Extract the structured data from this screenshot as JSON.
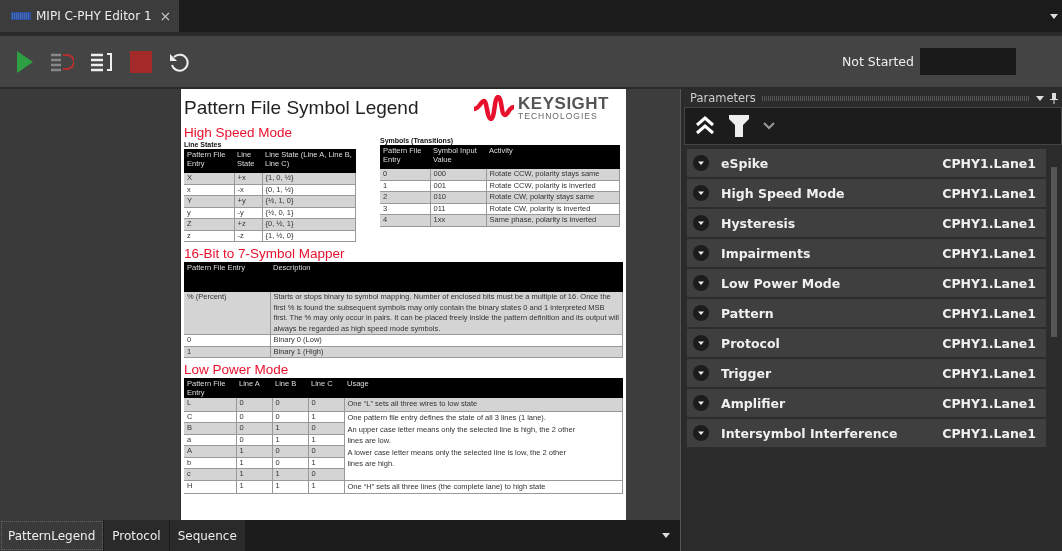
{
  "editor_tab": {
    "title": "MIPI C-PHY Editor 1",
    "close": "×"
  },
  "status": {
    "label": "Not Started"
  },
  "document": {
    "title": "Pattern File Symbol Legend",
    "logo": {
      "name": "KEYSIGHT",
      "sub": "TECHNOLOGIES"
    },
    "high_speed": {
      "heading": "High Speed Mode",
      "line_states": {
        "caption": "Line States",
        "columns": [
          "Pattern File Entry",
          "Line State",
          "Line State (Line A, Line B, Line C)"
        ],
        "rows": [
          [
            "X",
            "+x",
            "{1, 0, ½}"
          ],
          [
            "x",
            "-x",
            "{0, 1, ½}"
          ],
          [
            "Y",
            "+y",
            "{½, 1, 0}"
          ],
          [
            "y",
            "-y",
            "{½, 0, 1}"
          ],
          [
            "Z",
            "+z",
            "{0, ½, 1}"
          ],
          [
            "z",
            "-z",
            "{1, ½, 0}"
          ]
        ]
      },
      "symbols": {
        "caption": "Symbols (Transitions)",
        "columns": [
          "Pattern File Entry",
          "Symbol Input Value",
          "Activity"
        ],
        "rows": [
          [
            "0",
            "000",
            "Rotate CCW, polarity stays same"
          ],
          [
            "1",
            "001",
            "Rotate CCW, polarity is inverted"
          ],
          [
            "2",
            "010",
            "Rotate CW, polarity stays same"
          ],
          [
            "3",
            "011",
            "Rotate CW, polarity is inverted"
          ],
          [
            "4",
            "1xx",
            "Same phase, polarity is inverted"
          ]
        ]
      }
    },
    "mapper": {
      "heading": "16-Bit to 7-Symbol Mapper",
      "columns": [
        "Pattern File Entry",
        "Description"
      ],
      "rows": [
        [
          "% (Percent)",
          "Starts or stops binary to symbol mapping. Number of enclosed bits must be a multiple of 16. Once the first % is found the subsequent symbols may only contain the binary states 0 and 1 interpreted MSB first. The % may only occur in pairs. It can be placed freely inside the pattern definition and its output will always be regarded as high speed mode symbols."
        ],
        [
          "0",
          "Binary 0 (Low)"
        ],
        [
          "1",
          "Binary 1 (High)"
        ]
      ]
    },
    "low_power": {
      "heading": "Low Power Mode",
      "columns": [
        "Pattern File Entry",
        "Line A",
        "Line B",
        "Line C",
        "Usage"
      ],
      "rows": [
        {
          "entry": "L",
          "a": "0",
          "b": "0",
          "c": "0",
          "usage": [
            "One “L” sets all three wires to low state"
          ]
        },
        {
          "entry": "C",
          "a": "0",
          "b": "0",
          "c": "1",
          "usage": [
            "One pattern file entry defines the state of all 3 lines (1 lane).",
            "An upper case letter means only the selected line is high, the 2 other lines are low.",
            "A lower case letter means only the selected line is low, the 2 other lines are high."
          ]
        },
        {
          "entry": "B",
          "a": "0",
          "b": "1",
          "c": "0"
        },
        {
          "entry": "a",
          "a": "0",
          "b": "1",
          "c": "1"
        },
        {
          "entry": "A",
          "a": "1",
          "b": "0",
          "c": "0"
        },
        {
          "entry": "b",
          "a": "1",
          "b": "0",
          "c": "1"
        },
        {
          "entry": "c",
          "a": "1",
          "b": "1",
          "c": "0"
        },
        {
          "entry": "H",
          "a": "1",
          "b": "1",
          "c": "1",
          "usage": [
            "One “H” sets all three lines (the complete lane) to high state"
          ]
        }
      ]
    }
  },
  "bottom_tabs": [
    {
      "label": "PatternLegend",
      "selected": true
    },
    {
      "label": "Protocol",
      "selected": false
    },
    {
      "label": "Sequence",
      "selected": false
    }
  ],
  "parameters": {
    "title": "Parameters",
    "items": [
      {
        "name": "eSpike",
        "value": "CPHY1.Lane1",
        "expanded": false
      },
      {
        "name": "High Speed Mode",
        "value": "CPHY1.Lane1",
        "expanded": false
      },
      {
        "name": "Hysteresis",
        "value": "CPHY1.Lane1",
        "expanded": false
      },
      {
        "name": "Impairments",
        "value": "CPHY1.Lane1",
        "expanded": false
      },
      {
        "name": "Low Power Mode",
        "value": "CPHY1.Lane1",
        "expanded": false
      },
      {
        "name": "Pattern",
        "value": "CPHY1.Lane1",
        "expanded": false
      },
      {
        "name": "Protocol",
        "value": "CPHY1.Lane1",
        "expanded": false
      },
      {
        "name": "Trigger",
        "value": "CPHY1.Lane1",
        "expanded": false
      },
      {
        "name": "Amplifier",
        "value": "CPHY1.Lane1",
        "expanded": false
      },
      {
        "name": "Intersymbol Interference",
        "value": "CPHY1.Lane1",
        "expanded": false
      }
    ]
  }
}
